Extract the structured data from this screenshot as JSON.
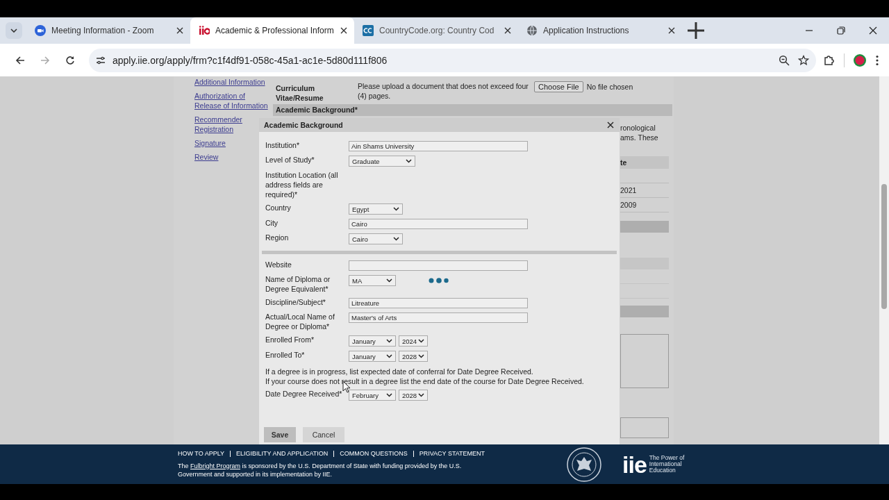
{
  "browser": {
    "tabs": [
      {
        "label": "Meeting Information - Zoom",
        "selected": false
      },
      {
        "label": "Academic & Professional Inform",
        "selected": true
      },
      {
        "label": "CountryCode.org: Country Cod",
        "selected": false
      },
      {
        "label": "Application Instructions",
        "selected": false
      }
    ],
    "url_domain": "apply.iie.org",
    "url_path": "/apply/frm?c1f4df91-058c-45a1-ac1e-5d80d111f806"
  },
  "sidebar": {
    "items": [
      {
        "label": "Additional Information"
      },
      {
        "label": "Authorization of Release of Information"
      },
      {
        "label": "Recommender Registration"
      },
      {
        "label": "Signature"
      },
      {
        "label": "Review"
      }
    ]
  },
  "cv": {
    "label": "Curriculum Vitae/Resume",
    "help": "Please upload a document that does not exceed four (4) pages.",
    "button": "Choose File",
    "status": "No file chosen"
  },
  "section_header": "Academic Background*",
  "background_fragments": {
    "paragraph": [
      "ronological",
      "ams. These"
    ],
    "column_header": "te",
    "rows": [
      "2021",
      "2009"
    ]
  },
  "dialog": {
    "title": "Academic Background",
    "sections": [
      {
        "fields": [
          {
            "kind": "text",
            "label": "Institution*",
            "value": "Ain Shams University"
          },
          {
            "kind": "select",
            "label": "Level of Study*",
            "value": "Graduate"
          },
          {
            "kind": "heading",
            "label": "Institution Location (all address fields are required)*"
          },
          {
            "kind": "select",
            "label": "Country",
            "value": "Egypt"
          },
          {
            "kind": "text",
            "label": "City",
            "value": "Cairo"
          },
          {
            "kind": "select",
            "label": "Region",
            "value": "Cairo"
          }
        ]
      },
      {
        "fields": [
          {
            "kind": "text",
            "label": "Website"
          },
          {
            "kind": "select",
            "label": "Name of Diploma or Degree Equivalent*",
            "value": "MA"
          },
          {
            "kind": "text",
            "label": "Discipline/Subject*",
            "value": "Litreature"
          },
          {
            "kind": "text",
            "label": "Actual/Local Name of Degree or Diploma*",
            "value": "Master's of Arts"
          },
          {
            "kind": "date",
            "label": "Enrolled From*",
            "month": "January",
            "year": "2024"
          },
          {
            "kind": "date",
            "label": "Enrolled To*",
            "month": "January",
            "year": "2028"
          },
          {
            "kind": "note",
            "lines": [
              "If a degree is in progress, list expected date of conferral for Date Degree Received.",
              "If your course does not result in a degree list the end date of the course for Date Degree Received."
            ]
          },
          {
            "kind": "date",
            "label": "Date Degree Received*",
            "month": "February",
            "year": "2028"
          }
        ]
      }
    ],
    "buttons": [
      "Save",
      "Cancel"
    ]
  },
  "footer": {
    "links": [
      "HOW TO APPLY",
      "ELIGIBILITY AND APPLICATION",
      "COMMON QUESTIONS",
      "PRIVACY STATEMENT"
    ],
    "text_before": "The",
    "link": "Fulbright Program",
    "text_after": "is sponsored by the U.S. Department of State with funding provided by the U.S. Government and supported in its implementation by IIE.",
    "logo": "iie",
    "tagline": "The Power of International Education"
  }
}
